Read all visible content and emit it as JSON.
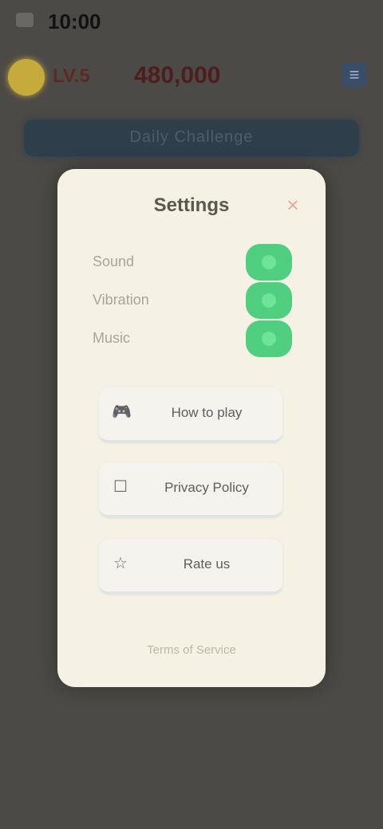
{
  "status_bar": {
    "time": "10:00"
  },
  "game_header": {
    "level_label": "LV.5",
    "score": "480,000",
    "menu_icon": "menu-icon",
    "coin_color": "#c4ab3c"
  },
  "banner": {
    "text": "Daily Challenge"
  },
  "settings": {
    "title": "Settings",
    "close_glyph": "×",
    "toggles": [
      {
        "label": "Sound",
        "on": true
      },
      {
        "label": "Vibration",
        "on": true
      },
      {
        "label": "Music",
        "on": true
      }
    ],
    "buttons": [
      {
        "icon": "gamepad-icon",
        "glyph": "🎮",
        "label": "How to play"
      },
      {
        "icon": "checkbox-icon",
        "glyph": "☐",
        "label": "Privacy Policy"
      },
      {
        "icon": "star-icon",
        "glyph": "☆",
        "label": "Rate us"
      }
    ],
    "footer_link": "Terms of Service"
  },
  "colors": {
    "toggle_on": "#4fcf7f",
    "modal_bg": "#f5f1e4",
    "overlay_bg": "#4c4a46"
  }
}
